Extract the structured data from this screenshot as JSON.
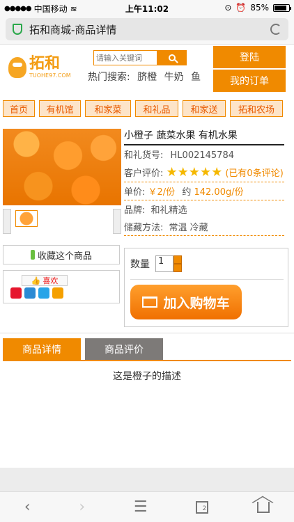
{
  "status": {
    "carrier": "中国移动",
    "time": "上午11:02",
    "battery": "85%"
  },
  "browser": {
    "title": "拓和商城-商品详情"
  },
  "header": {
    "logo_cn": "拓和",
    "logo_en": "TUOHE97.COM",
    "search_placeholder": "请输入关键词",
    "hot_label": "热门搜索:",
    "hot_terms": [
      "脐橙",
      "牛奶",
      "鱼"
    ],
    "login": "登陆",
    "orders": "我的订单"
  },
  "nav": [
    "首页",
    "有机馆",
    "和家菜",
    "和礼品",
    "和家送",
    "拓和农场"
  ],
  "product": {
    "title": "小橙子  蔬菜水果 有机水果",
    "sku_label": "和礼货号:",
    "sku": "HL002145784",
    "rating_label": "客户评价:",
    "rating_stars": 5,
    "rating_note": "(已有0条评论)",
    "price_label": "单价:",
    "price": "￥2/份",
    "approx": "约",
    "weight": "142.00g/份",
    "brand_label": "品牌:",
    "brand": "和礼精选",
    "storage_label": "储藏方法:",
    "storage": "常温  冷藏",
    "favorite": "收藏这个商品",
    "like": "喜欢",
    "qty_label": "数量",
    "qty_value": "1",
    "add_to_cart": "加入购物车"
  },
  "tabs": [
    "商品详情",
    "商品评价"
  ],
  "description": "这是橙子的描述",
  "toolbar": {
    "tab_count": "2"
  },
  "colors": {
    "accent": "#f08a00",
    "nav_bg": "#fde4c8",
    "tab_active": "#f08a00",
    "tab_inactive": "#7d7a78"
  }
}
